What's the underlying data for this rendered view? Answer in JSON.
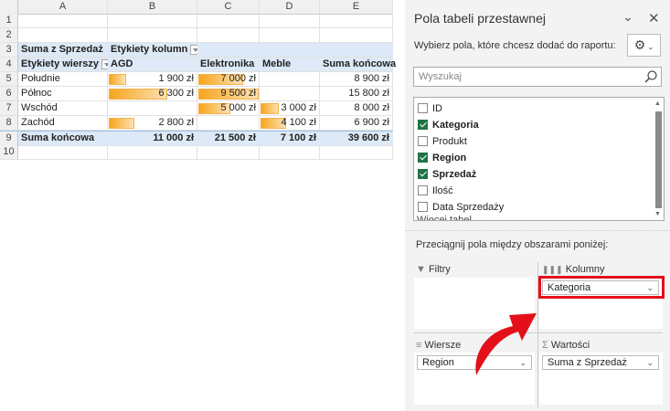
{
  "sheet": {
    "columns": [
      "A",
      "B",
      "C",
      "D",
      "E"
    ],
    "row_numbers": [
      "1",
      "2",
      "3",
      "4",
      "5",
      "6",
      "7",
      "8",
      "9",
      "10"
    ],
    "values_label": "Suma z Sprzedaż",
    "column_labels": "Etykiety kolumn",
    "row_labels": "Etykiety wierszy",
    "col_headers": [
      "AGD",
      "Elektronika",
      "Meble",
      "Suma końcowa"
    ],
    "rows": [
      {
        "label": "Południe",
        "cells": [
          "1 900 zł",
          "7 000 zł",
          "",
          "8 900 zł"
        ],
        "bars": [
          1900,
          7000,
          null
        ]
      },
      {
        "label": "Północ",
        "cells": [
          "6 300 zł",
          "9 500 zł",
          "",
          "15 800 zł"
        ],
        "bars": [
          6300,
          9500,
          null
        ]
      },
      {
        "label": "Wschód",
        "cells": [
          "",
          "5 000 zł",
          "3 000 zł",
          "8 000 zł"
        ],
        "bars": [
          null,
          5000,
          3000
        ]
      },
      {
        "label": "Zachód",
        "cells": [
          "2 800 zł",
          "",
          "4 100 zł",
          "6 900 zł"
        ],
        "bars": [
          2800,
          null,
          4100
        ]
      }
    ],
    "total": {
      "label": "Suma końcowa",
      "cells": [
        "11 000 zł",
        "21 500 zł",
        "7 100 zł",
        "39 600 zł"
      ]
    },
    "bar_max": 9500,
    "bar_color": "#f7a51e"
  },
  "panel": {
    "title": "Pola tabeli przestawnej",
    "subtitle": "Wybierz pola, które chcesz dodać do raportu:",
    "search_placeholder": "Wyszukaj",
    "fields": [
      {
        "label": "ID",
        "checked": false
      },
      {
        "label": "Kategoria",
        "checked": true
      },
      {
        "label": "Produkt",
        "checked": false
      },
      {
        "label": "Region",
        "checked": true
      },
      {
        "label": "Sprzedaż",
        "checked": true
      },
      {
        "label": "Ilość",
        "checked": false
      },
      {
        "label": "Data Sprzedaży",
        "checked": false
      }
    ],
    "more_tables": "Więcej tabel...",
    "drag_hint": "Przeciągnij pola między obszarami poniżej:",
    "areas": {
      "filters": {
        "label": "Filtry",
        "items": []
      },
      "columns": {
        "label": "Kolumny",
        "items": [
          "Kategoria"
        ]
      },
      "rows": {
        "label": "Wiersze",
        "items": [
          "Region"
        ]
      },
      "values": {
        "label": "Wartości",
        "items": [
          "Suma z Sprzedaż"
        ]
      }
    },
    "highlight_color": "#e3101a"
  }
}
